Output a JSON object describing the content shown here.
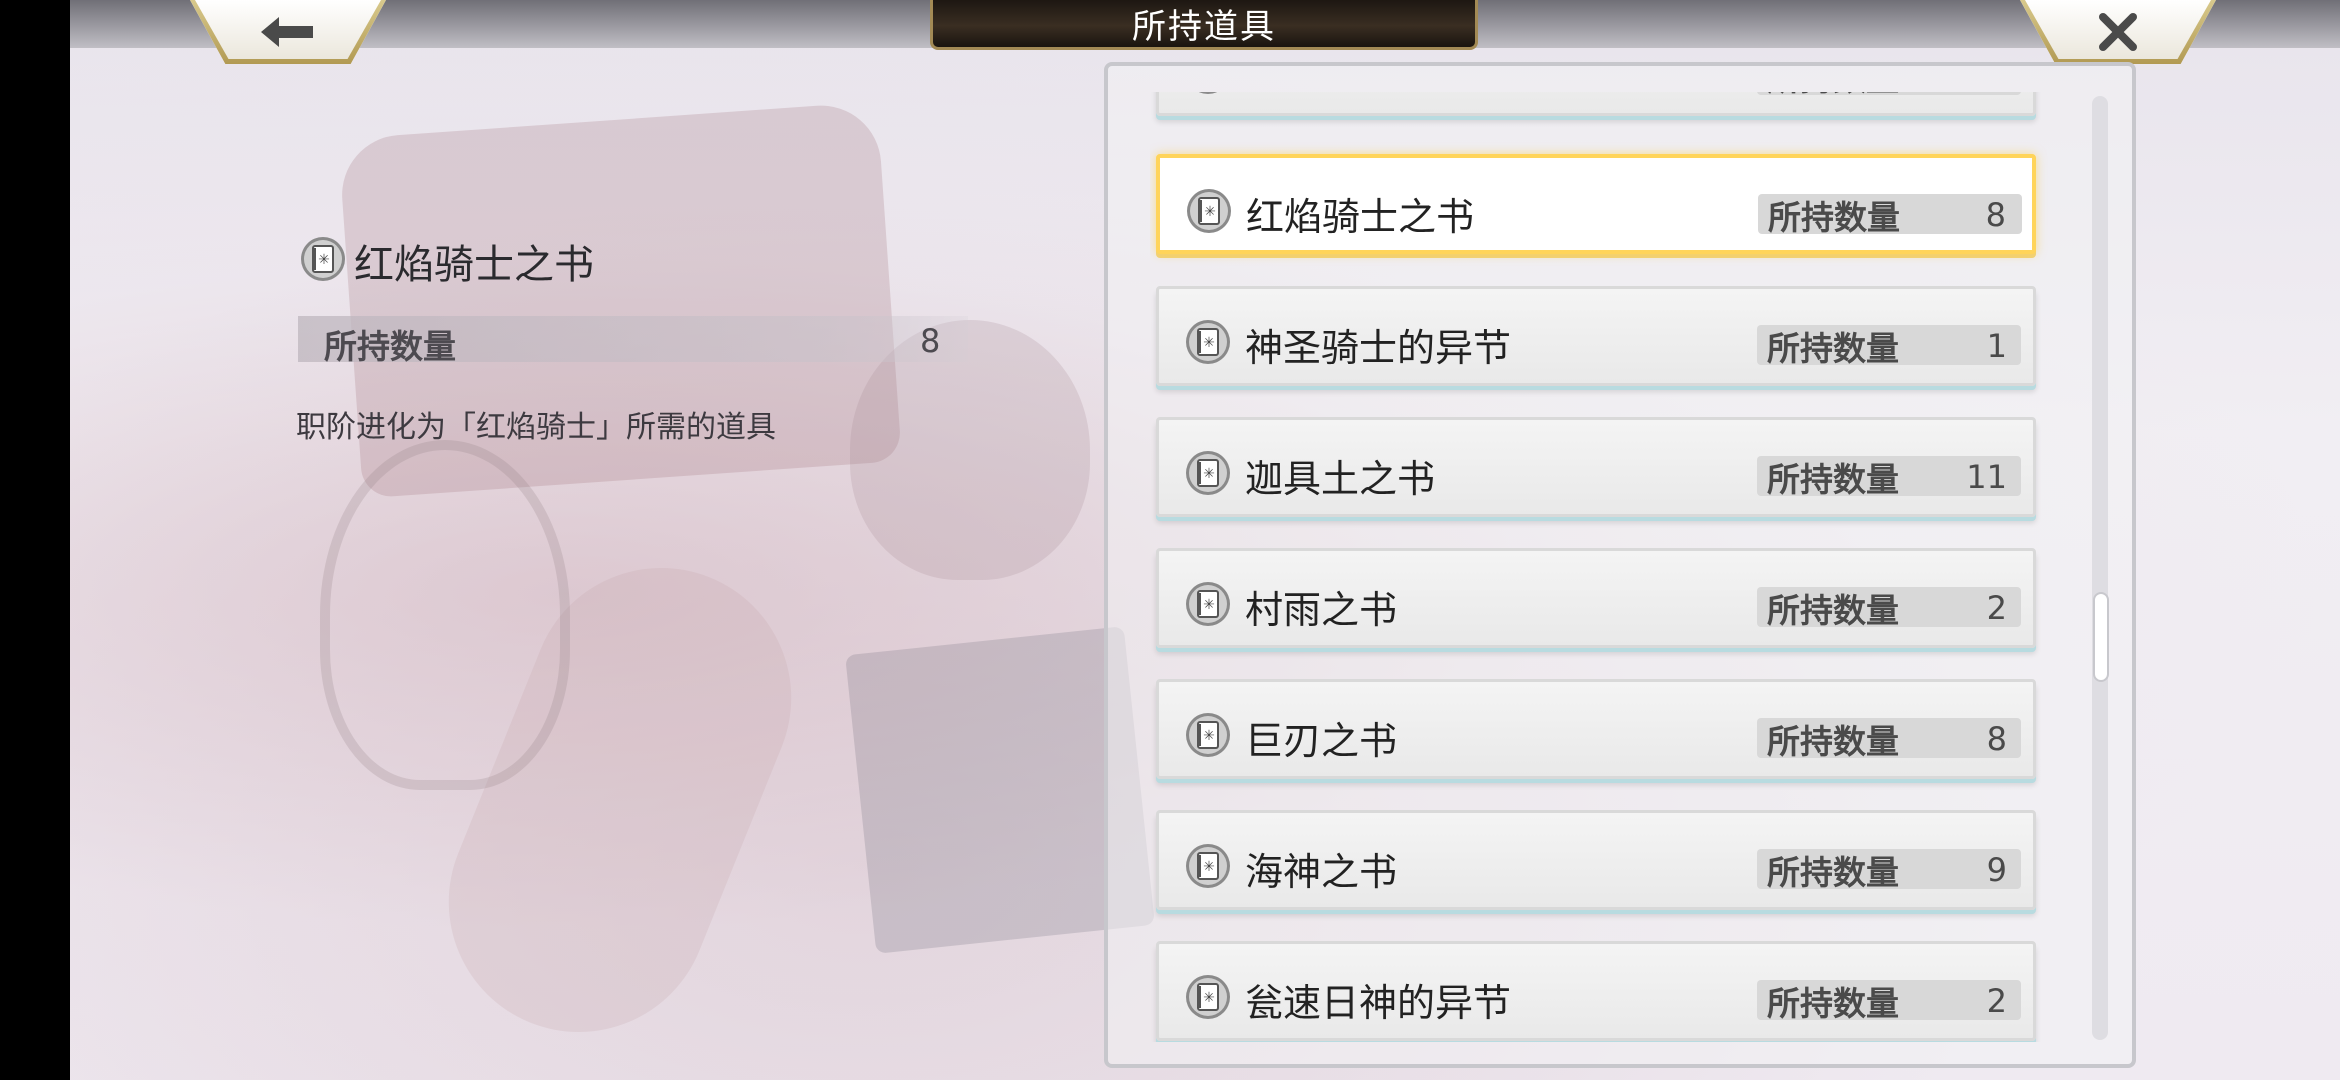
{
  "header": {
    "title": "所持道具"
  },
  "icons": {
    "back": "back-arrow-icon",
    "close": "close-x-icon",
    "item": "book-item-icon"
  },
  "detail": {
    "name": "红焰骑士之书",
    "qty_label": "所持数量",
    "qty_value": "8",
    "description": "职阶进化为「红焰骑士」所需的道具"
  },
  "list": {
    "items": [
      {
        "name": "",
        "qty_label": "所持数量",
        "qty": ""
      },
      {
        "name": "红焰骑士之书",
        "qty_label": "所持数量",
        "qty": "8",
        "selected": true
      },
      {
        "name": "神圣骑士的异节",
        "qty_label": "所持数量",
        "qty": "1"
      },
      {
        "name": "迦具土之书",
        "qty_label": "所持数量",
        "qty": "11"
      },
      {
        "name": "村雨之书",
        "qty_label": "所持数量",
        "qty": "2"
      },
      {
        "name": "巨刃之书",
        "qty_label": "所持数量",
        "qty": "8"
      },
      {
        "name": "海神之书",
        "qty_label": "所持数量",
        "qty": "9"
      },
      {
        "name": "瓮速日神的异节",
        "qty_label": "所持数量",
        "qty": "2"
      }
    ]
  },
  "colors": {
    "selected_border": "#ffd45a",
    "title_plate": "#2a2119",
    "accent_gold": "#b29a53"
  }
}
